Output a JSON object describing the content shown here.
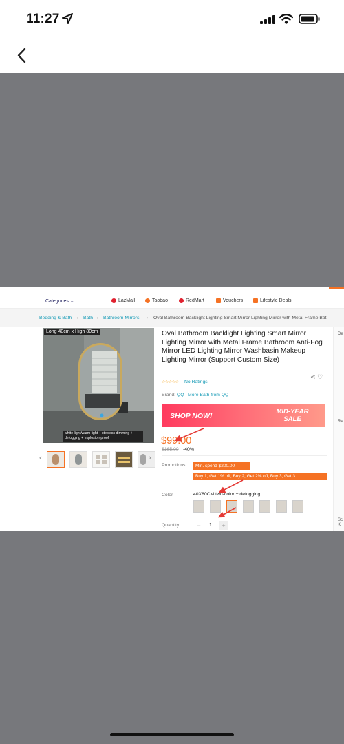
{
  "status_bar": {
    "time": "11:27"
  },
  "shot": {
    "top_nav": {
      "categories_label": "Categories",
      "links": [
        "LazMall",
        "Taobao",
        "RedMart",
        "Vouchers",
        "Lifestyle Deals"
      ]
    },
    "breadcrumb": {
      "items": [
        "Bedding & Bath",
        "Bath",
        "Bathroom Mirrors"
      ],
      "current": "Oval Bathroom Backlight Lighting Smart Mirror Lighting Mirror with Metal Frame Bat"
    },
    "gallery": {
      "size_label": "Long 40cm x High 80cm",
      "caption": "white light/warm light + stepless dimming + defogging + explosion-proof"
    },
    "product": {
      "title": "Oval Bathroom Backlight Lighting Smart Mirror Lighting Mirror with Metal Frame Bathroom Anti-Fog Mirror LED Lighting Mirror Washbasin Makeup Lighting Mirror (Support Custom Size)",
      "ratings": "No Ratings",
      "brand_label": "Brand:",
      "brand": "QQ",
      "more_from": "More Bath from QQ",
      "banner_left": "SHOP NOW!",
      "banner_right": "MID-YEAR SALE",
      "price": "$99.00",
      "old_price": "$165.00",
      "discount": "-40%",
      "promotions_label": "Promotions",
      "promo_1": "Min. spend $200.00",
      "promo_2": "Buy 1, Get 1% off, Buy 2, Get 2% off, Buy 3, Get 3...",
      "color_label": "Color",
      "color_value": "40X80CM two-color + defogging",
      "quantity_label": "Quantity",
      "quantity": "1"
    },
    "right_strip": {
      "items": [
        "De",
        "Re",
        "Sc Ki"
      ]
    }
  },
  "colors": {
    "accent": "#f57224",
    "link": "#1a9cb7",
    "viewer_bg": "#77787c",
    "annotation": "#e53935"
  }
}
